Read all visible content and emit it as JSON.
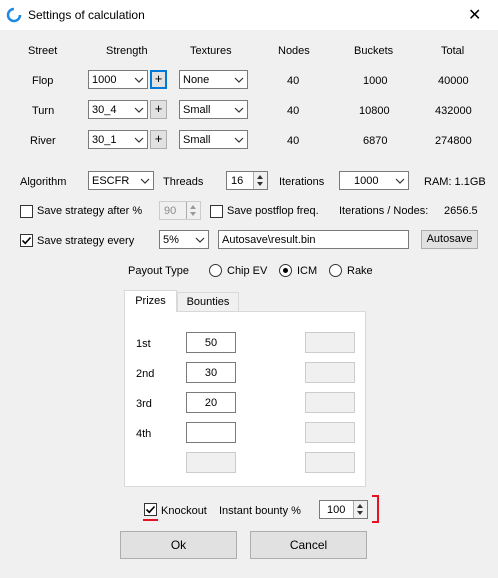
{
  "window": {
    "title": "Settings of calculation",
    "close_glyph": "✕"
  },
  "columns": {
    "street": "Street",
    "strength": "Strength",
    "textures": "Textures",
    "nodes": "Nodes",
    "buckets": "Buckets",
    "total": "Total"
  },
  "rows": [
    {
      "street": "Flop",
      "strength": "1000",
      "textures": "None",
      "nodes": "40",
      "buckets": "1000",
      "total": "40000"
    },
    {
      "street": "Turn",
      "strength": "30_4",
      "textures": "Small",
      "nodes": "40",
      "buckets": "10800",
      "total": "432000"
    },
    {
      "street": "River",
      "strength": "30_1",
      "textures": "Small",
      "nodes": "40",
      "buckets": "6870",
      "total": "274800"
    }
  ],
  "plus_label": "+",
  "algorithm": {
    "label": "Algorithm",
    "value": "ESCFR"
  },
  "threads": {
    "label": "Threads",
    "value": "16"
  },
  "iterations": {
    "label": "Iterations",
    "value": "1000"
  },
  "ram": "RAM: 1.1GB",
  "save_after": {
    "label": "Save strategy after %",
    "value": "90",
    "checked": false
  },
  "save_postflop": {
    "label": "Save postflop freq.",
    "checked": false
  },
  "iter_per_node": {
    "label": "Iterations / Nodes:",
    "value": "2656.5"
  },
  "save_every": {
    "label": "Save strategy every",
    "value": "5%",
    "checked": true
  },
  "autosave": {
    "path": "Autosave\\result.bin",
    "button": "Autosave"
  },
  "payout": {
    "label": "Payout Type",
    "options": [
      "Chip EV",
      "ICM",
      "Rake"
    ],
    "selected": "ICM"
  },
  "tabs": [
    "Prizes",
    "Bounties"
  ],
  "prizes": [
    {
      "place": "1st",
      "value": "50"
    },
    {
      "place": "2nd",
      "value": "30"
    },
    {
      "place": "3rd",
      "value": "20"
    },
    {
      "place": "4th",
      "value": ""
    }
  ],
  "knockout": {
    "label": "Knockout",
    "checked": true
  },
  "instant_bounty": {
    "label": "Instant bounty %",
    "value": "100"
  },
  "buttons": {
    "ok": "Ok",
    "cancel": "Cancel"
  },
  "colors": {
    "focus": "#0078d7",
    "annotation": "#e81123"
  }
}
